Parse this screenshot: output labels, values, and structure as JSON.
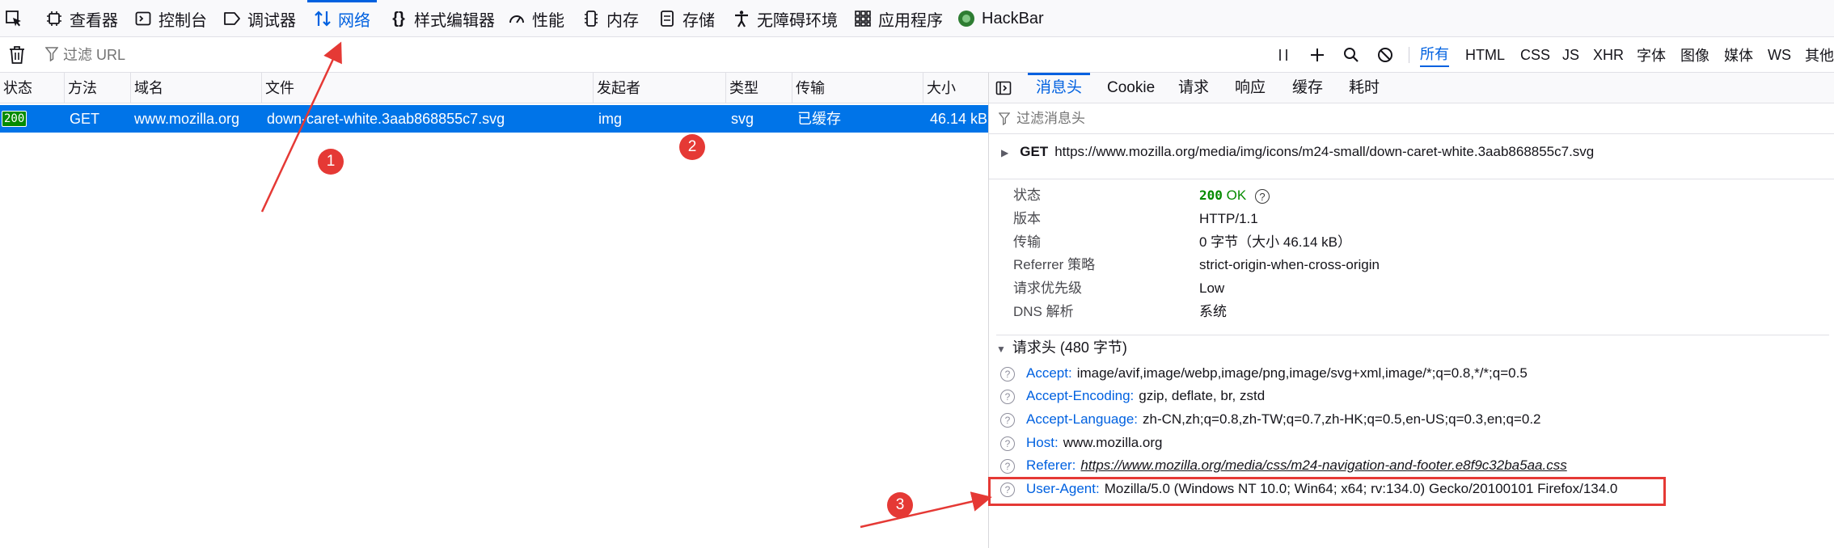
{
  "toolbar": {
    "tabs": [
      {
        "label": "查看器",
        "icon": "inspector-icon"
      },
      {
        "label": "控制台",
        "icon": "console-icon"
      },
      {
        "label": "调试器",
        "icon": "debugger-icon"
      },
      {
        "label": "网络",
        "icon": "network-icon",
        "active": true
      },
      {
        "label": "样式编辑器",
        "icon": "style-editor-icon"
      },
      {
        "label": "性能",
        "icon": "performance-icon"
      },
      {
        "label": "内存",
        "icon": "memory-icon"
      },
      {
        "label": "存储",
        "icon": "storage-icon"
      },
      {
        "label": "无障碍环境",
        "icon": "accessibility-icon"
      },
      {
        "label": "应用程序",
        "icon": "application-icon"
      },
      {
        "label": "HackBar",
        "icon": "hackbar-icon"
      }
    ]
  },
  "filterbar": {
    "placeholder": "过滤 URL",
    "type_filters": [
      "所有",
      "HTML",
      "CSS",
      "JS",
      "XHR",
      "字体",
      "图像",
      "媒体",
      "WS",
      "其他"
    ],
    "active_filter": "所有"
  },
  "table": {
    "columns": [
      "状态",
      "方法",
      "域名",
      "文件",
      "发起者",
      "类型",
      "传输",
      "大小"
    ],
    "rows": [
      {
        "status": "200",
        "method": "GET",
        "domain": "www.mozilla.org",
        "file": "down-caret-white.3aab868855c7.svg",
        "initiator": "img",
        "type": "svg",
        "transfer": "已缓存",
        "size": "46.14 kB"
      }
    ]
  },
  "details": {
    "tabs": [
      "消息头",
      "Cookie",
      "请求",
      "响应",
      "缓存",
      "耗时"
    ],
    "active_tab": "消息头",
    "filter_placeholder": "过滤消息头",
    "request_method": "GET",
    "request_url": "https://www.mozilla.org/media/img/icons/m24-small/down-caret-white.3aab868855c7.svg",
    "summary": {
      "status_label": "状态",
      "status_code": "200",
      "status_text": "OK",
      "version_label": "版本",
      "version_value": "HTTP/1.1",
      "transfer_label": "传输",
      "transfer_value": "0 字节（大小 46.14 kB）",
      "referrer_policy_label": "Referrer 策略",
      "referrer_policy_value": "strict-origin-when-cross-origin",
      "priority_label": "请求优先级",
      "priority_value": "Low",
      "dns_label": "DNS 解析",
      "dns_value": "系统"
    },
    "request_headers_title": "请求头 (480 字节)",
    "request_headers": [
      {
        "name": "Accept:",
        "value": "image/avif,image/webp,image/png,image/svg+xml,image/*;q=0.8,*/*;q=0.5"
      },
      {
        "name": "Accept-Encoding:",
        "value": "gzip, deflate, br, zstd"
      },
      {
        "name": "Accept-Language:",
        "value": "zh-CN,zh;q=0.8,zh-TW;q=0.7,zh-HK;q=0.5,en-US;q=0.3,en;q=0.2"
      },
      {
        "name": "Host:",
        "value": "www.mozilla.org"
      },
      {
        "name": "Referer:",
        "value": "https://www.mozilla.org/media/css/m24-navigation-and-footer.e8f9c32ba5aa.css"
      },
      {
        "name": "User-Agent:",
        "value": "Mozilla/5.0 (Windows NT 10.0; Win64; x64; rv:134.0) Gecko/20100101 Firefox/134.0"
      }
    ]
  },
  "annotations": {
    "badges": [
      "1",
      "2",
      "3"
    ],
    "accent_color": "#e53935"
  },
  "colors": {
    "selected_row": "#0074e8",
    "active_tab": "#0061e0",
    "status_ok": "#058b00",
    "header_name": "#0061e0"
  }
}
